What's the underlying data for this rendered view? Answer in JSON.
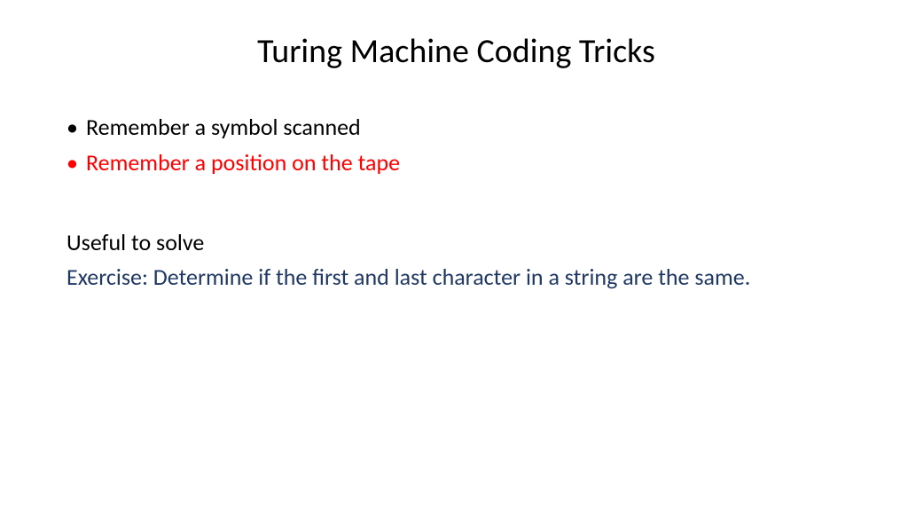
{
  "slide": {
    "title": "Turing Machine Coding Tricks",
    "bullets": {
      "item1": "Remember a symbol scanned",
      "item2": "Remember a position on the tape"
    },
    "subtitle": "Useful to solve",
    "exercise": "Exercise: Determine if the first and last character in a string are the same."
  },
  "colors": {
    "black": "#000000",
    "red": "#ff0000",
    "navy": "#203864"
  }
}
